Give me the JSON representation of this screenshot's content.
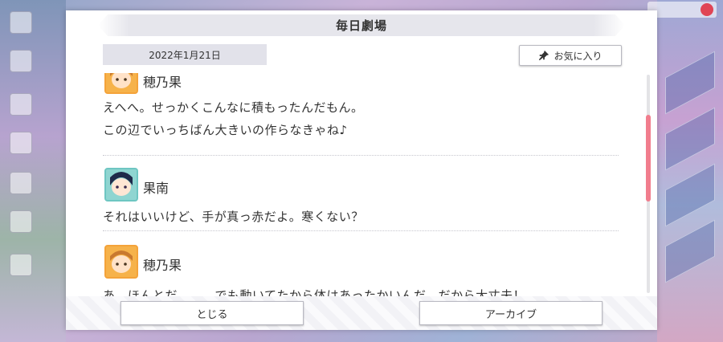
{
  "dialog": {
    "title": "毎日劇場",
    "date": "2022年1月21日",
    "favorite_label": "お気に入り",
    "close_label": "とじる",
    "archive_label": "アーカイブ"
  },
  "entries": [
    {
      "speaker": "穂乃果",
      "avatar_icon": "honoka-avatar-icon",
      "lines": [
        "えへへ。せっかくこんなに積もったんだもん。",
        "この辺でいっちばん大きいの作らなきゃね♪"
      ]
    },
    {
      "speaker": "果南",
      "avatar_icon": "kanan-avatar-icon",
      "lines": [
        "それはいいけど、手が真っ赤だよ。寒くない？"
      ]
    },
    {
      "speaker": "穂乃果",
      "avatar_icon": "honoka-avatar-icon",
      "lines": [
        "あ、ほんとだ……。でも動いてたから体はあったかいんだ。だから大丈夫！"
      ]
    }
  ],
  "colors": {
    "scrollbar_thumb": "#f17d8d",
    "honoka_frame": "#f6b24a",
    "kanan_frame": "#8fd5d1"
  }
}
